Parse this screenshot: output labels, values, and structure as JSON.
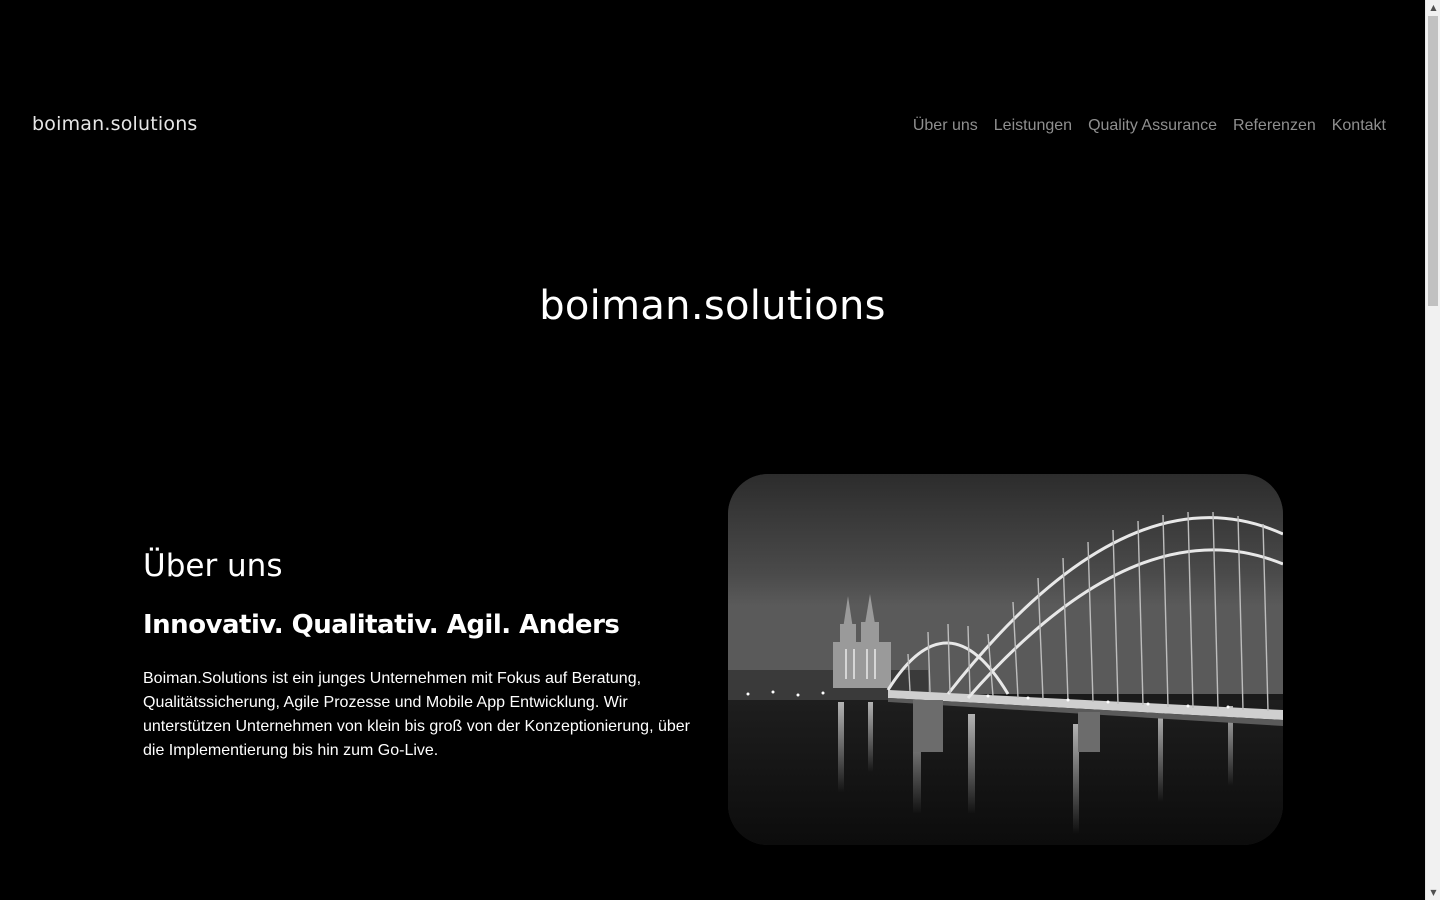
{
  "header": {
    "brand": "boiman.solutions",
    "nav": [
      {
        "label": "Über uns"
      },
      {
        "label": "Leistungen"
      },
      {
        "label": "Quality Assurance"
      },
      {
        "label": "Referenzen"
      },
      {
        "label": "Kontakt"
      }
    ]
  },
  "hero": {
    "title": "boiman.solutions"
  },
  "about": {
    "heading": "Über uns",
    "subheading": "Innovativ. Qualitativ. Agil. Anders",
    "text": "Boiman.Solutions ist ein junges Unternehmen mit Fokus auf Beratung, Qualitätssicherung, Agile Prozesse und Mobile App Entwicklung. Wir unterstützen Unternehmen von klein bis groß von der Konzeptionierung, über die Implementierung bis hin zum Go-Live."
  },
  "scrollbar": {
    "up_icon": "triangle-up-icon",
    "down_icon": "triangle-down-icon",
    "position": 0.0
  },
  "colors": {
    "background": "#000000",
    "text": "#ffffff",
    "nav_text": "#8f8f8f",
    "brand_text": "#e6e6e6"
  }
}
